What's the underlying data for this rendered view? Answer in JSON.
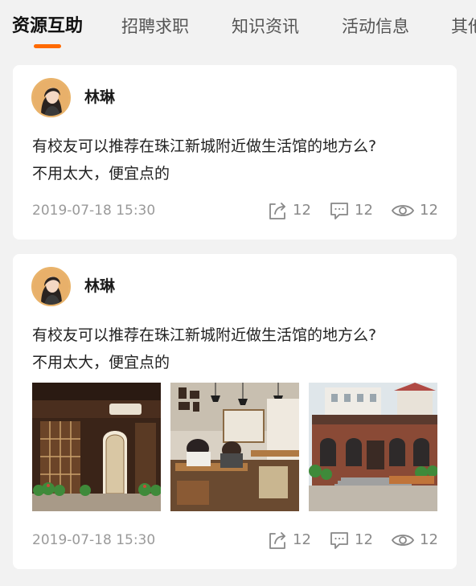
{
  "tabs": [
    {
      "label": "资源互助",
      "active": true
    },
    {
      "label": "招聘求职",
      "active": false
    },
    {
      "label": "知识资讯",
      "active": false
    },
    {
      "label": "活动信息",
      "active": false
    },
    {
      "label": "其他",
      "active": false
    }
  ],
  "accent_color": "#ff6a00",
  "posts": [
    {
      "author": "林琳",
      "text_line1": "有校友可以推荐在珠江新城附近做生活馆的地方么?",
      "text_line2": "不用太大，便宜点的",
      "timestamp": "2019-07-18 15:30",
      "shares": "12",
      "comments": "12",
      "views": "12",
      "images": []
    },
    {
      "author": "林琳",
      "text_line1": "有校友可以推荐在珠江新城附近做生活馆的地方么?",
      "text_line2": "不用太大，便宜点的",
      "timestamp": "2019-07-18 15:30",
      "shares": "12",
      "comments": "12",
      "views": "12",
      "images": [
        "cafe-storefront-photo",
        "cafe-interior-photo",
        "brick-building-photo"
      ]
    }
  ],
  "icons": {
    "share": "share-icon",
    "comment": "comment-icon",
    "view": "eye-icon"
  }
}
